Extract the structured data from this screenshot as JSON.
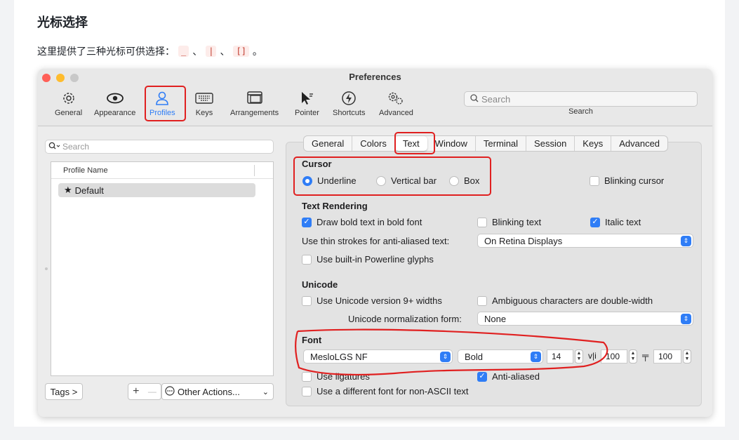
{
  "doc": {
    "heading": "光标选择",
    "paragraph": "这里提供了三种光标可供选择：",
    "chips": [
      "_",
      "|",
      "[]"
    ],
    "sep": "、",
    "end": "。"
  },
  "window": {
    "title": "Preferences",
    "toolbar": [
      {
        "label": "General",
        "icon": "gear-icon"
      },
      {
        "label": "Appearance",
        "icon": "eye-icon"
      },
      {
        "label": "Profiles",
        "icon": "person-icon"
      },
      {
        "label": "Keys",
        "icon": "keyboard-icon"
      },
      {
        "label": "Arrangements",
        "icon": "windows-icon"
      },
      {
        "label": "Pointer",
        "icon": "pointer-icon"
      },
      {
        "label": "Shortcuts",
        "icon": "lightning-icon"
      },
      {
        "label": "Advanced",
        "icon": "gears-icon"
      }
    ],
    "search_placeholder": "Search",
    "search_label": "Search"
  },
  "profiles": {
    "search_placeholder": "Search",
    "column_header": "Profile Name",
    "rows": [
      {
        "name": "Default",
        "star": "★"
      }
    ],
    "tags_button": "Tags >",
    "add_button": "+",
    "remove_button": "—",
    "other_actions": "Other Actions...",
    "other_actions_chevron": "⌄"
  },
  "tabs": [
    "General",
    "Colors",
    "Text",
    "Window",
    "Terminal",
    "Session",
    "Keys",
    "Advanced"
  ],
  "selected_tab": "Text",
  "cursor": {
    "heading": "Cursor",
    "options": [
      "Underline",
      "Vertical bar",
      "Box"
    ],
    "selected": "Underline",
    "blinking_label": "Blinking cursor",
    "blinking": false
  },
  "text_rendering": {
    "heading": "Text Rendering",
    "bold_label": "Draw bold text in bold font",
    "bold": true,
    "blinking_text_label": "Blinking text",
    "blinking_text": false,
    "italic_label": "Italic text",
    "italic": true,
    "thin_strokes_label": "Use thin strokes for anti-aliased text:",
    "thin_strokes_value": "On Retina Displays",
    "powerline_label": "Use built-in Powerline glyphs",
    "powerline": false
  },
  "unicode": {
    "heading": "Unicode",
    "v9_label": "Use Unicode version 9+ widths",
    "v9": false,
    "ambiguous_label": "Ambiguous characters are double-width",
    "ambiguous": false,
    "normalization_label": "Unicode normalization form:",
    "normalization_value": "None"
  },
  "font": {
    "heading": "Font",
    "family": "MesloLGS NF",
    "weight": "Bold",
    "size": "14",
    "vspacing_glyph": "v|i",
    "vspacing": "100",
    "hspacing_glyph": "╤",
    "hspacing": "100",
    "ligatures_label": "Use ligatures",
    "ligatures": false,
    "antialiased_label": "Anti-aliased",
    "antialiased": true,
    "nonascii_label": "Use a different font for non-ASCII text",
    "nonascii": false
  },
  "colors": {
    "accent": "#2f7df6",
    "highlight_red": "#e02020",
    "close": "#ff5f57",
    "minimize": "#febc2e",
    "zoom": "#c8c8c8"
  }
}
